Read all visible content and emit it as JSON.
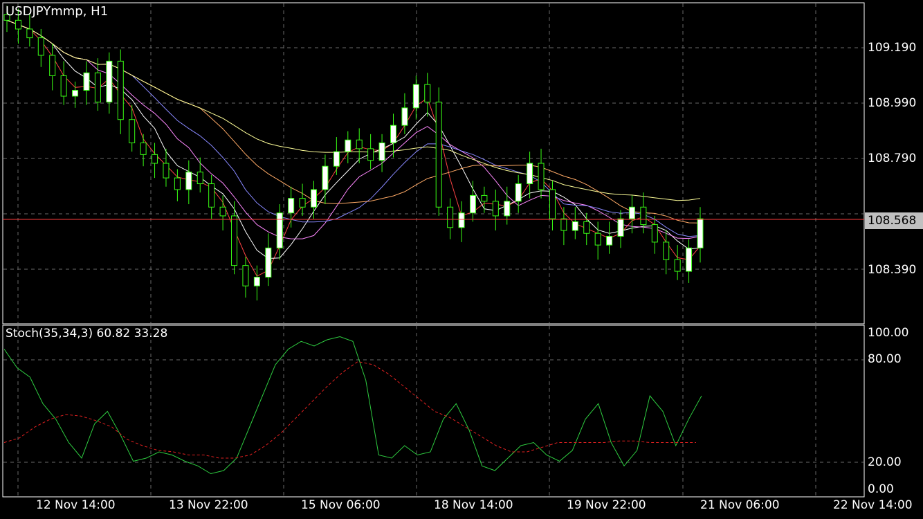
{
  "window": {
    "title": "USDJPYmmp, H1"
  },
  "price_axis": {
    "labels": [
      "109.190",
      "108.990",
      "108.790",
      "108.390"
    ],
    "current_price": "108.568"
  },
  "stoch": {
    "title": "Stoch(35,34,3) 60.82 33.28",
    "labels": [
      "100.00",
      "80.00",
      "20.00",
      "0.00"
    ]
  },
  "time_axis": {
    "labels": [
      "12 Nov 14:00",
      "13 Nov 22:00",
      "15 Nov 06:00",
      "18 Nov 14:00",
      "19 Nov 22:00",
      "21 Nov 06:00",
      "22 Nov 14:00"
    ]
  },
  "colors": {
    "background": "#000000",
    "grid": "#6a6a6a",
    "candle_up": "#ffffff",
    "candle_down": "#000000",
    "wick": "#39ff14",
    "price_line": "#ff3b3b",
    "stoch_main": "#2ecc40",
    "stoch_signal": "#e02020",
    "ma_yellow": "#ffff99"
  },
  "chart_data": [
    {
      "type": "candlestick",
      "title": "USDJPYmmp, H1",
      "ylim": [
        108.2,
        109.3
      ],
      "close": [
        109.24,
        109.21,
        109.18,
        109.12,
        109.05,
        108.98,
        109.0,
        109.06,
        108.96,
        109.1,
        108.9,
        108.82,
        108.78,
        108.75,
        108.7,
        108.66,
        108.72,
        108.68,
        108.6,
        108.57,
        108.4,
        108.33,
        108.36,
        108.46,
        108.58,
        108.63,
        108.6,
        108.66,
        108.74,
        108.79,
        108.83,
        108.8,
        108.76,
        108.82,
        108.88,
        108.94,
        109.02,
        108.96,
        108.6,
        108.53,
        108.58,
        108.64,
        108.62,
        108.57,
        108.62,
        108.68,
        108.75,
        108.66,
        108.56,
        108.52,
        108.55,
        108.51,
        108.47,
        108.5,
        108.56,
        108.6,
        108.54,
        108.48,
        108.42,
        108.38,
        108.46,
        108.56
      ],
      "current_price": 108.568
    },
    {
      "type": "line",
      "title": "Stoch(35,34,3) 60.82 33.28",
      "ylim": [
        0,
        100
      ],
      "series": [
        {
          "values": [
            90,
            78,
            72,
            55,
            45,
            30,
            20,
            42,
            50,
            35,
            18,
            20,
            24,
            22,
            18,
            15,
            10,
            12,
            20,
            40,
            60,
            80,
            90,
            95,
            92,
            96,
            98,
            95,
            70,
            22,
            20,
            28,
            22,
            24,
            45,
            55,
            38,
            15,
            12,
            20,
            28,
            30,
            22,
            18,
            25,
            45,
            55,
            30,
            15,
            25,
            60,
            50,
            28,
            45,
            60
          ]
        },
        {
          "values": [
            30,
            33,
            40,
            45,
            48,
            47,
            44,
            40,
            32,
            28,
            25,
            24,
            22,
            22,
            20,
            20,
            22,
            28,
            36,
            46,
            56,
            66,
            75,
            82,
            80,
            74,
            66,
            58,
            50,
            46,
            40,
            34,
            28,
            24,
            24,
            27,
            30,
            30,
            30,
            30,
            31,
            31,
            30,
            30,
            30,
            30
          ]
        }
      ]
    }
  ]
}
